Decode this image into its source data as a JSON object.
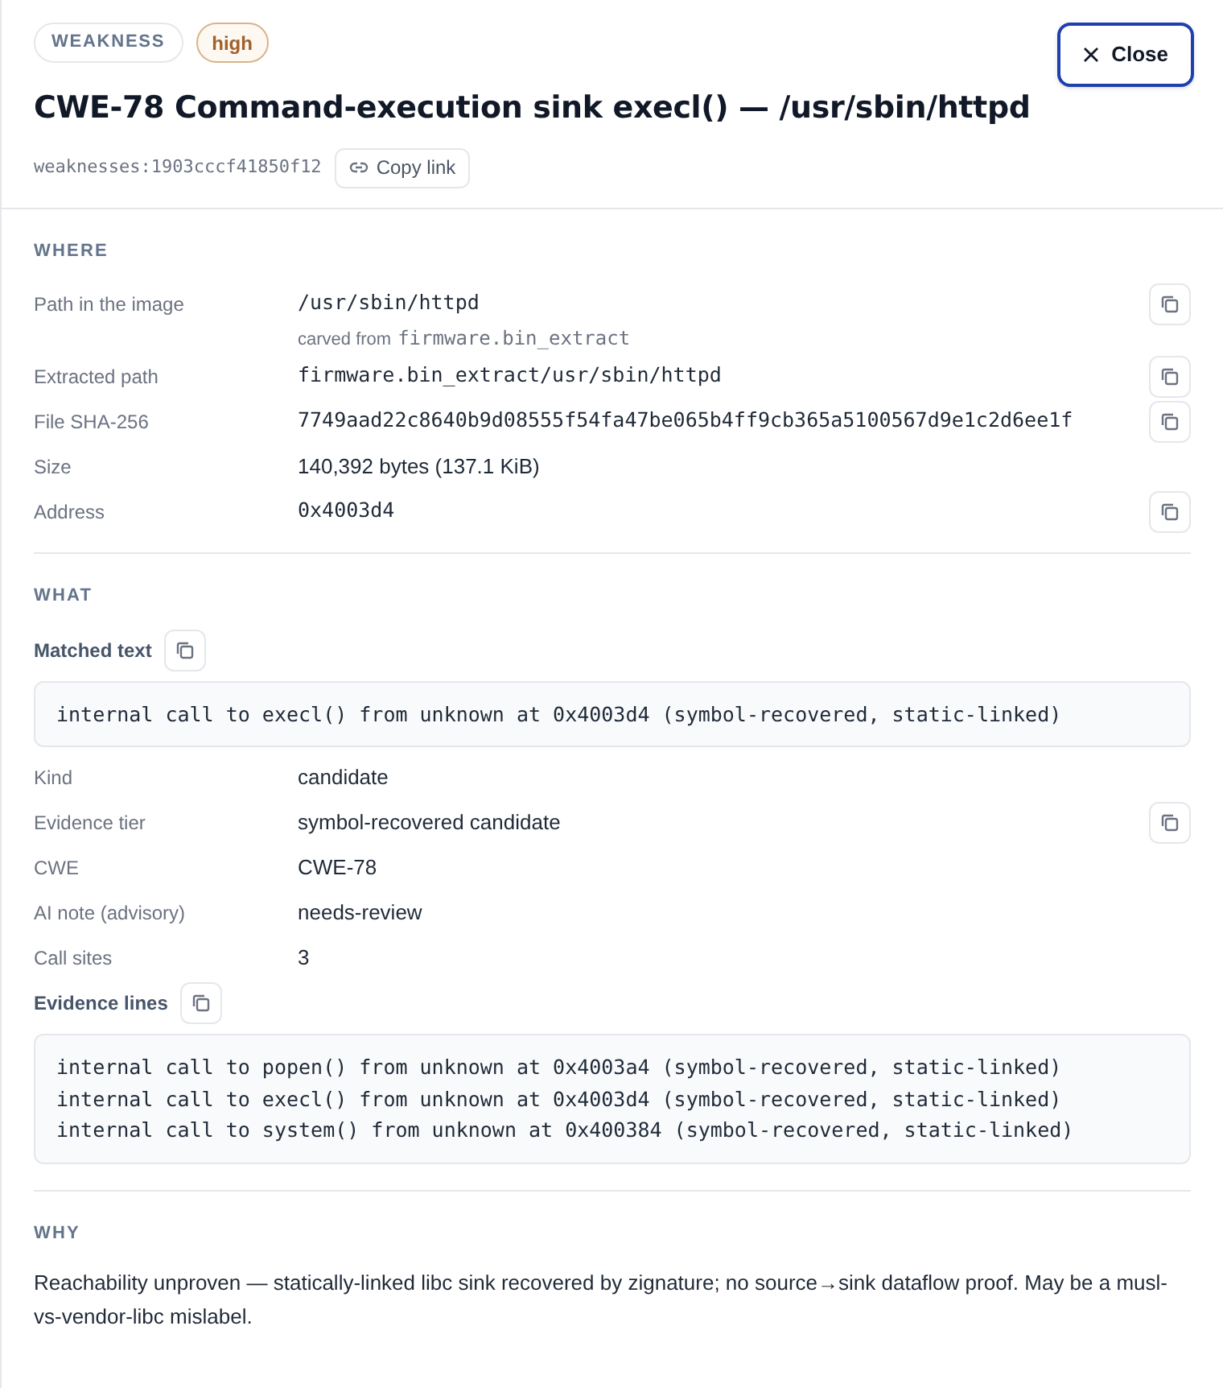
{
  "header": {
    "tags": [
      {
        "label": "WEAKNESS",
        "kind": "type"
      },
      {
        "label": "high",
        "kind": "severity"
      }
    ],
    "title": "CWE-78 Command-execution sink execl() — /usr/sbin/httpd",
    "id": "weaknesses:1903cccf41850f12",
    "copy_link": "Copy link",
    "close": "Close"
  },
  "sections": [
    {
      "heading": "WHERE",
      "items": [
        {
          "kind": "field",
          "label": "Path in the image",
          "value": "/usr/sbin/httpd",
          "mono": true,
          "copyable": true,
          "note": {
            "prefix": "carved from",
            "value": "firmware.bin_extract"
          }
        },
        {
          "kind": "field",
          "label": "Extracted path",
          "value": "firmware.bin_extract/usr/sbin/httpd",
          "mono": true,
          "copyable": true
        },
        {
          "kind": "field",
          "label": "File SHA-256",
          "value": "7749aad22c8640b9d08555f54fa47be065b4ff9cb365a5100567d9e1c2d6ee1f",
          "mono": true,
          "copyable": true
        },
        {
          "kind": "field",
          "label": "Size",
          "value": "140,392 bytes (137.1 KiB)",
          "mono": false,
          "copyable": false
        },
        {
          "kind": "field",
          "label": "Address",
          "value": "0x4003d4",
          "mono": true,
          "copyable": true
        }
      ]
    },
    {
      "heading": "WHAT",
      "items": [
        {
          "kind": "block",
          "label": "Matched text",
          "lines": [
            "internal call to execl() from unknown at 0x4003d4 (symbol-recovered, static-linked)"
          ]
        },
        {
          "kind": "field",
          "label": "Kind",
          "value": "candidate",
          "mono": false,
          "copyable": false
        },
        {
          "kind": "field",
          "label": "Evidence tier",
          "value": "symbol-recovered candidate",
          "mono": false,
          "copyable": true
        },
        {
          "kind": "field",
          "label": "CWE",
          "value": "CWE-78",
          "mono": false,
          "copyable": false
        },
        {
          "kind": "field",
          "label": "AI note (advisory)",
          "value": "needs-review",
          "mono": false,
          "copyable": false
        },
        {
          "kind": "field",
          "label": "Call sites",
          "value": "3",
          "mono": false,
          "copyable": false
        },
        {
          "kind": "block",
          "label": "Evidence lines",
          "lines": [
            "internal call to popen() from unknown at 0x4003a4 (symbol-recovered, static-linked)",
            "internal call to execl() from unknown at 0x4003d4 (symbol-recovered, static-linked)",
            "internal call to system() from unknown at 0x400384 (symbol-recovered, static-linked)"
          ]
        }
      ]
    },
    {
      "heading": "WHY",
      "items": [
        {
          "kind": "paragraph",
          "text": "Reachability unproven — statically-linked libc sink recovered by zignature; no source→sink dataflow proof. May be a musl-vs-vendor-libc mislabel."
        }
      ]
    }
  ]
}
